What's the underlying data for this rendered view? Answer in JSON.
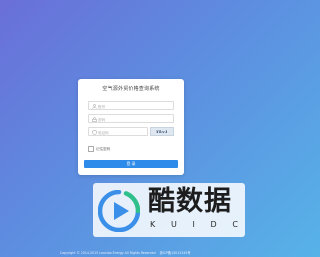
{
  "login": {
    "title": "空气源外贸价格查询系统",
    "username_placeholder": "账号",
    "password_placeholder": "密码",
    "captcha_placeholder": "验证码",
    "captcha_text": "Ykv1",
    "remember_label": "记住密码",
    "login_button": "登 录"
  },
  "watermark": {
    "name": "酷数据",
    "subtitle": [
      "K",
      "U",
      "I",
      "D",
      "C"
    ]
  },
  "footer": {
    "copyright": "Copyright © 2014-2015 Lanxiao Energy All Rights Reserved",
    "icp": "浙ICP备15012345号"
  },
  "colors": {
    "primary": "#2f8bea",
    "logo_blue": "#3a8fe8",
    "logo_green": "#2fbf8a"
  }
}
